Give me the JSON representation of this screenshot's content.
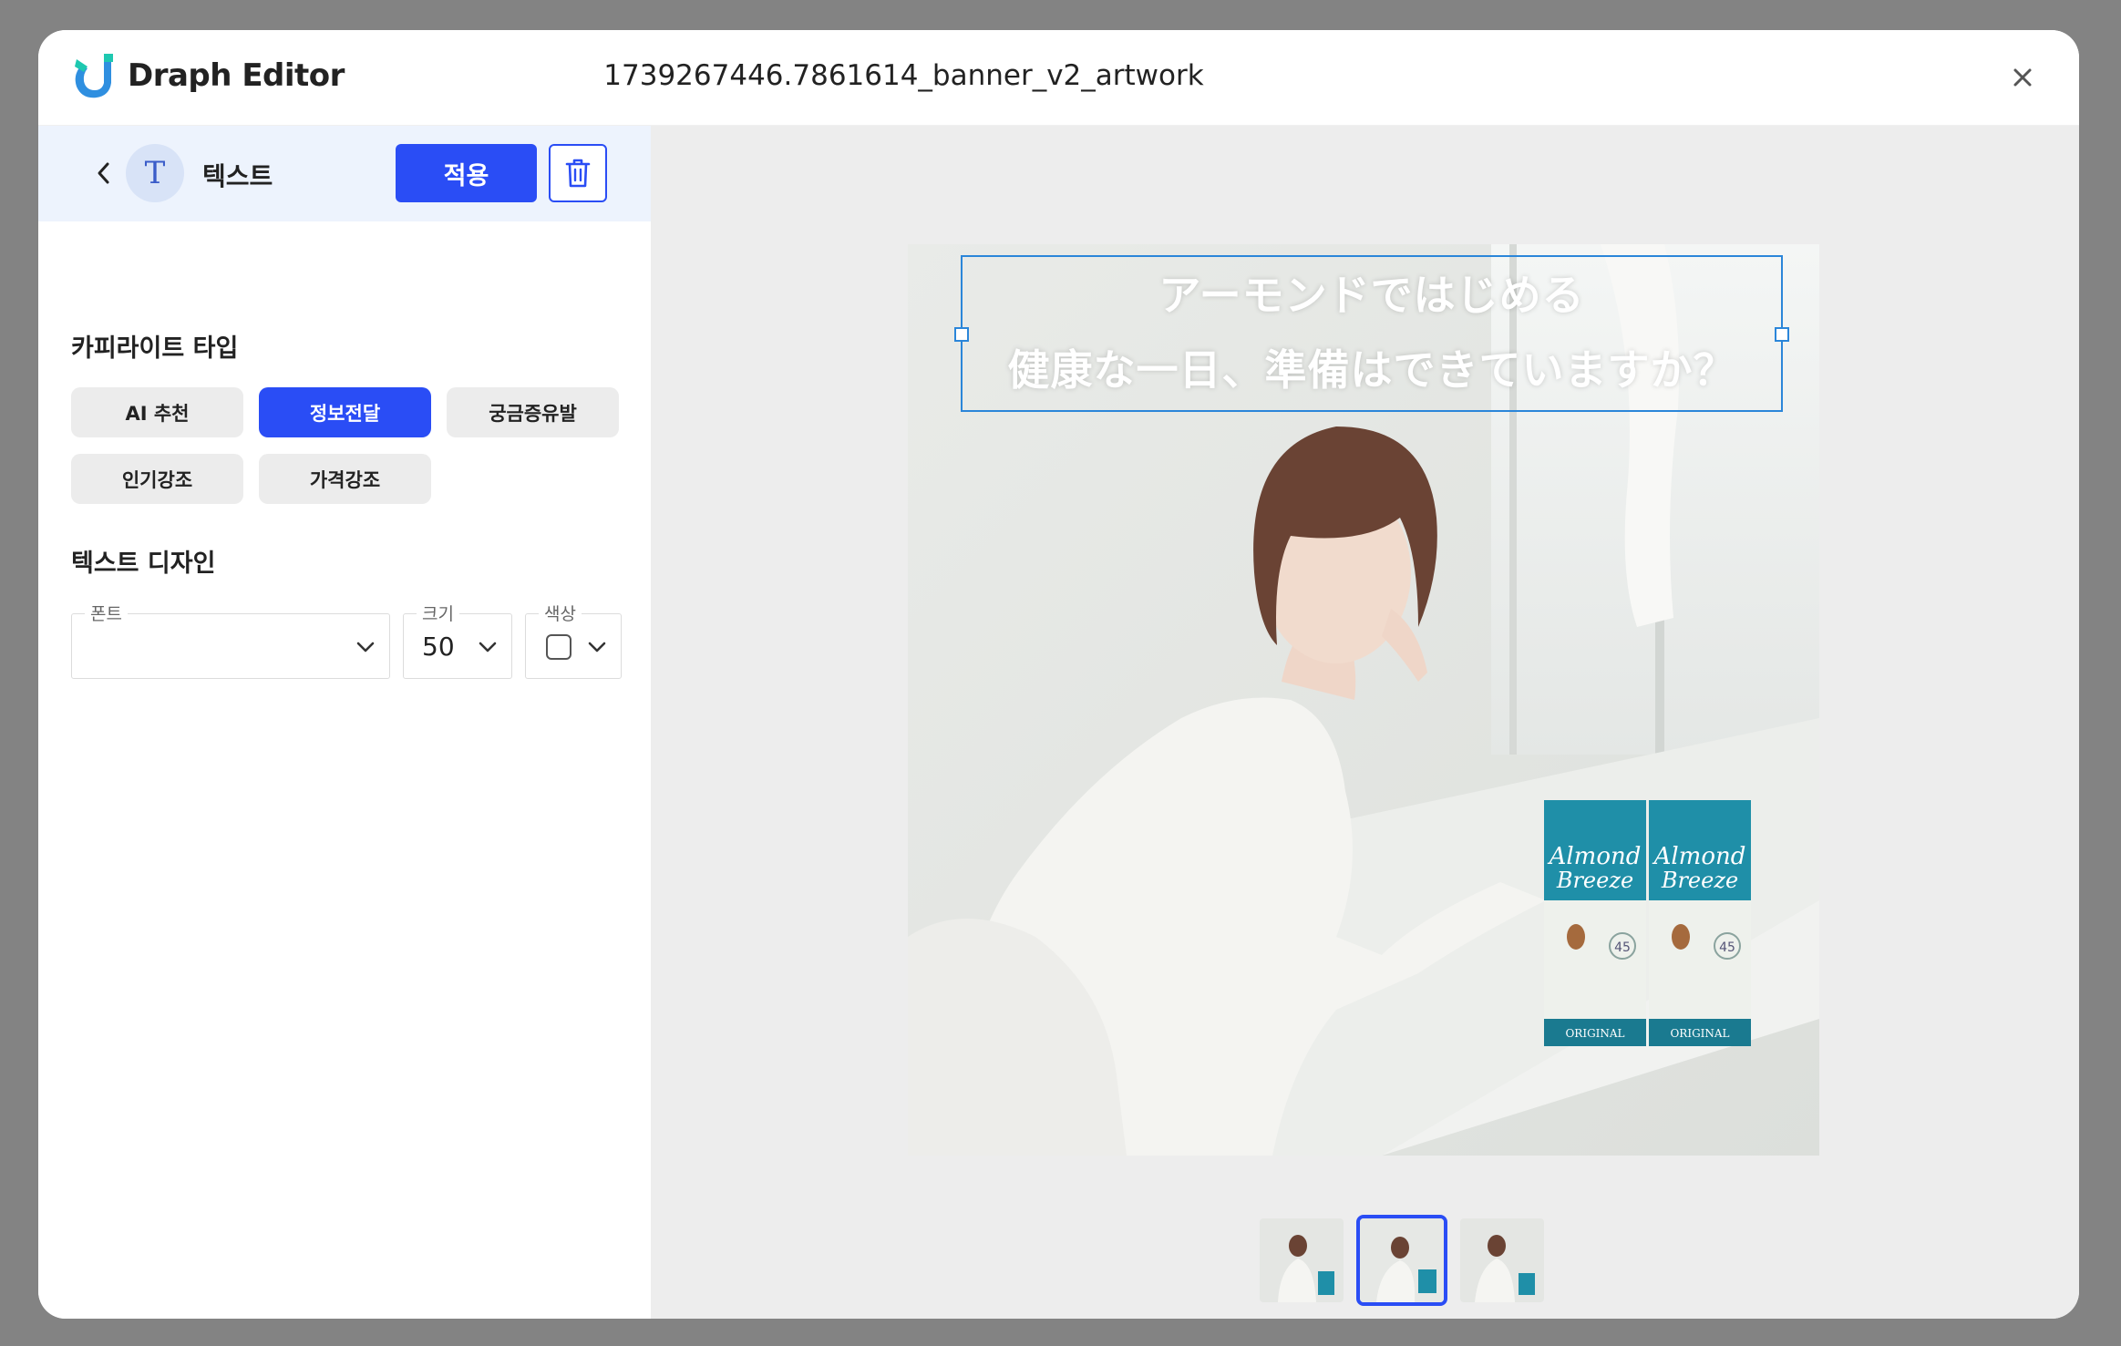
{
  "app": {
    "name": "Draph Editor",
    "document_title": "1739267446.7861614_banner_v2_artwork",
    "logo_icon": "draph-logo-icon",
    "close_icon": "close-icon"
  },
  "toolbar": {
    "back_icon": "chevron-left-icon",
    "tool_icon_glyph": "T",
    "tool_label": "텍스트",
    "apply_label": "적용",
    "delete_icon": "trash-icon"
  },
  "copy_type": {
    "title": "카피라이트 타입",
    "options": [
      {
        "label": "AI 추천",
        "active": false
      },
      {
        "label": "정보전달",
        "active": true
      },
      {
        "label": "궁금증유발",
        "active": false
      },
      {
        "label": "인기강조",
        "active": false
      },
      {
        "label": "가격강조",
        "active": false
      }
    ]
  },
  "text_design": {
    "title": "텍스트 디자인",
    "font_label": "폰트",
    "font_value": "",
    "size_label": "크기",
    "size_value": "50",
    "color_label": "색상",
    "color_value": "#ffffff"
  },
  "canvas": {
    "copy_lines": [
      "アーモンドではじめる",
      "健康な一日、準備はできていますか？"
    ],
    "product_brand": "Almond Breeze",
    "product_variant": "ORIGINAL",
    "product_count": "45"
  },
  "thumbnails": {
    "count": 3,
    "selected_index": 1
  },
  "colors": {
    "accent": "#2a4df5",
    "toolbar_bg": "#edf3fd",
    "canvas_bg": "#ededed",
    "selection": "#2b86d9",
    "overlay": "#838383"
  }
}
